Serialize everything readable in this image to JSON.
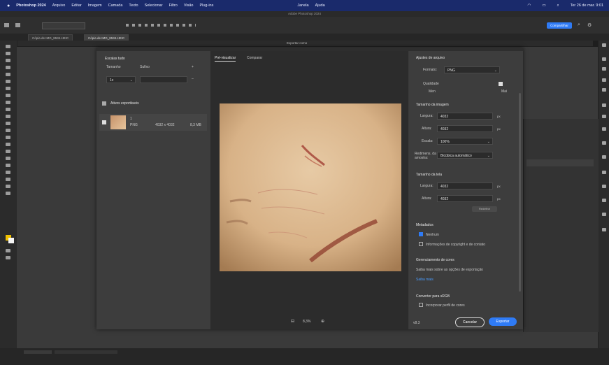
{
  "menubar": {
    "app": "Photoshop 2024",
    "items": [
      "Arquivo",
      "Editar",
      "Imagem",
      "Camada",
      "Texto",
      "Selecionar",
      "Filtro",
      "Visão",
      "Plug-ins",
      "Janela",
      "Ajuda"
    ],
    "clock": "Ter 26 de mar. 9:01"
  },
  "window_title": "Adobe Photoshop 2024",
  "options": {
    "share_label": "Compartilhar"
  },
  "doc_tabs": [
    "Cópia de IMG_8534.HEIC",
    "Cópia de IMG_8534.HEIC"
  ],
  "dialog": {
    "title": "Exportar como",
    "left": {
      "scale_header": "Escalas tudo",
      "col_size": "Tamanho",
      "col_suffix": "Sufixo",
      "scale_value": "1x",
      "assets_header": "Ativos exportáveis",
      "asset_name": "1",
      "asset_format": "PNG",
      "asset_dims": "4032 x 4032",
      "asset_size": "8,3 MB"
    },
    "preview_tabs": [
      "Pré-visualizar",
      "Comparar"
    ],
    "zoom": "8,3%",
    "right": {
      "file_settings": "Ajustes de arquivo",
      "format_label": "Formato:",
      "format_value": "PNG",
      "transparency_label": "Qualidade",
      "smaller_file_label": "Men",
      "smaller_file_value": "Mai",
      "image_size": "Tamanho da imagem",
      "width_label": "Largura:",
      "width_value": "4032",
      "height_label": "Altura:",
      "height_value": "4032",
      "scale_label": "Escala:",
      "scale_value": "100%",
      "resample_label": "Redimens. da amostra:",
      "resample_value": "Bicúbica automático",
      "px_unit": "px",
      "canvas_size": "Tamanho da tela",
      "canvas_width_label": "Largura:",
      "canvas_width_value": "4032",
      "canvas_height_label": "Altura:",
      "canvas_height_value": "4032",
      "reset_label": "Redefinir",
      "metadata": "Metadados",
      "meta_none": "Nenhum",
      "meta_copyright": "Informações de copyright e de contato",
      "color_header": "Gerenciamento de cores",
      "color_embed": "Converter para sRGB",
      "color_profile": "Incorporar perfil de cores",
      "learn_more": "Saiba mais sobre as opções de exportação",
      "learn_link": "Saiba mais",
      "footer_version": "v8.3",
      "cancel": "Cancelar",
      "export": "Exportar"
    }
  },
  "colors": {
    "accent": "#2f7bf5",
    "menubar": "#1a2a6b"
  }
}
